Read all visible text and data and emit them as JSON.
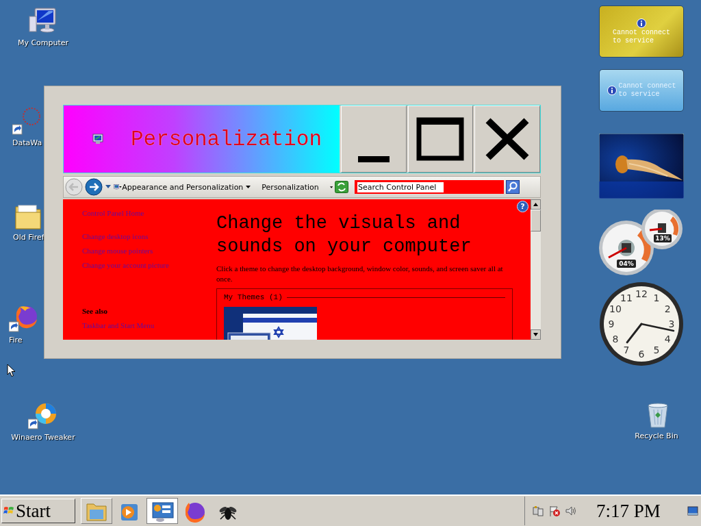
{
  "desktop_icons": [
    {
      "label": "My Computer",
      "kind": "computer",
      "shortcut": false
    },
    {
      "label": "DataWa",
      "kind": "app",
      "shortcut": true
    },
    {
      "label": "Old Firef",
      "kind": "folder",
      "shortcut": false
    },
    {
      "label": "Fire",
      "kind": "browser",
      "shortcut": true
    },
    {
      "label": "Winaero Tweaker",
      "kind": "tweaker",
      "shortcut": true
    },
    {
      "label": "Recycle Bin",
      "kind": "bin",
      "shortcut": false
    }
  ],
  "window": {
    "title": "Personalization",
    "address": {
      "crumbs": [
        "Appearance and Personalization",
        "Personalization"
      ]
    },
    "search": {
      "placeholder": "Search Control Panel"
    },
    "help": "?",
    "sidebar": {
      "links": [
        "Control Panel Home",
        "Change desktop icons",
        "Change mouse pointers",
        "Change your account picture"
      ],
      "see_also_heading": "See also",
      "see_also_links": [
        "Taskbar and Start Menu"
      ]
    },
    "heading": "Change the visuals and sounds on your computer",
    "description": "Click a theme to change the desktop background, window color, sounds, and screen saver all at once.",
    "themes_group": {
      "legend": "My Themes (1)"
    }
  },
  "gadgets": {
    "notices": [
      {
        "kind": "gold",
        "text": "Cannot connect to service"
      },
      {
        "kind": "blue",
        "text": "Cannot connect to service"
      }
    ],
    "gauges": [
      {
        "reading": "04%"
      },
      {
        "reading": "13%"
      }
    ],
    "clock": {
      "numerals": [
        "12",
        "11",
        "1",
        "10",
        "2",
        "9",
        "3",
        "8",
        "4",
        "7",
        "5",
        "6"
      ]
    }
  },
  "taskbar": {
    "start": "Start",
    "quick_launch": [
      {
        "kind": "folder",
        "selected": false
      },
      {
        "kind": "media",
        "selected": false
      },
      {
        "kind": "panel",
        "selected": true
      },
      {
        "kind": "browser",
        "selected": false
      },
      {
        "kind": "bug",
        "selected": false
      }
    ],
    "time": "7:17 PM"
  }
}
